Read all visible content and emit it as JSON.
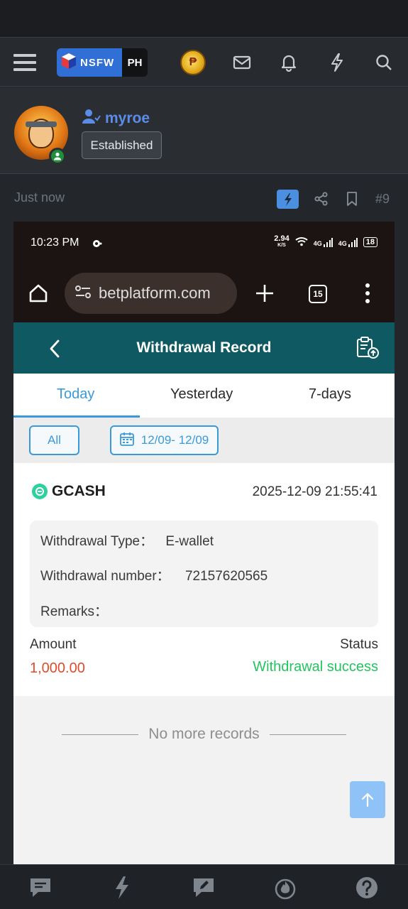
{
  "site": {
    "logo_left": "NSFW",
    "logo_right": "PH"
  },
  "header_icons": [
    "menu-icon",
    "token-icon",
    "mail-icon",
    "bell-icon",
    "bolt-icon",
    "search-icon"
  ],
  "user": {
    "name": "myroe",
    "badge": "Established"
  },
  "post": {
    "time": "Just now",
    "number": "#9"
  },
  "screenshot": {
    "status_time": "10:23 PM",
    "speed": "2.94",
    "speed_unit": "K/S",
    "network1": "4G",
    "network2": "4G",
    "battery": "18",
    "url": "betplatform.com",
    "tab_count": "15",
    "page_title": "Withdrawal Record",
    "tabs": [
      "Today",
      "Yesterday",
      "7-days"
    ],
    "filter_all": "All",
    "filter_date": "12/09- 12/09",
    "record": {
      "method": "GCASH",
      "datetime": "2025-12-09 21:55:41",
      "type_label": "Withdrawal Type：",
      "type_value": "E-wallet",
      "number_label": "Withdrawal number：",
      "number_value": "72157620565",
      "remarks_label": "Remarks：",
      "amount_label": "Amount",
      "amount_value": "1,000.00",
      "status_label": "Status",
      "status_value": "Withdrawal success"
    },
    "no_more": "No more records"
  },
  "colors": {
    "accent_blue": "#3a9ad9",
    "teal_header": "#0f5a62",
    "amount_red": "#e24a2c",
    "success_green": "#22c55e",
    "username_blue": "#5b8ce8"
  }
}
